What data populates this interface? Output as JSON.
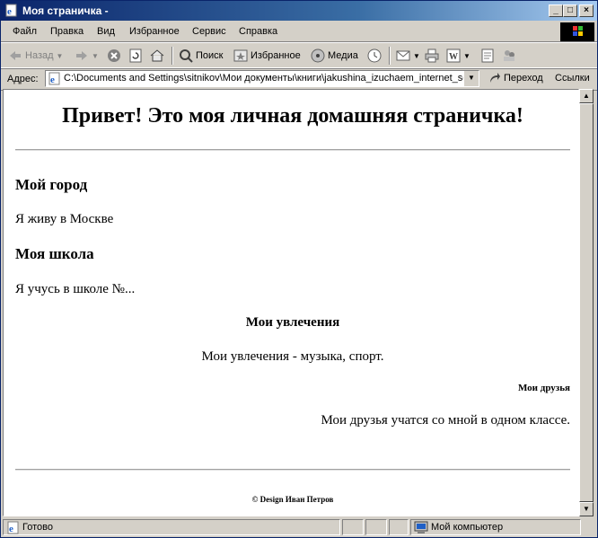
{
  "window": {
    "title": "Моя страничка -",
    "controls": {
      "minimize": "_",
      "maximize": "□",
      "close": "×"
    }
  },
  "menu": {
    "items": [
      "Файл",
      "Правка",
      "Вид",
      "Избранное",
      "Сервис",
      "Справка"
    ]
  },
  "toolbar": {
    "back_label": "Назад",
    "search_label": "Поиск",
    "favorites_label": "Избранное",
    "media_label": "Медиа"
  },
  "address": {
    "label": "Адрес:",
    "value": "C:\\Documents and Settings\\sitnikov\\Мои документы\\книги\\jakushina_izuchaem_internet_so",
    "go_label": "Переход",
    "links_label": "Ссылки"
  },
  "page": {
    "heading": "Привет! Это моя личная домашняя страничка!",
    "city_heading": "Мой город",
    "city_text": "Я живу в Москве",
    "school_heading": "Моя школа",
    "school_text": "Я учусь в школе №...",
    "hobbies_heading": "Мои увлечения",
    "hobbies_text": "Мои увлечения - музыка, спорт.",
    "friends_heading": "Мои друзья",
    "friends_text": "Мои друзья учатся со мной в одном классе.",
    "footer": "© Design Иван Петров"
  },
  "status": {
    "text": "Готово",
    "zone": "Мой компьютер"
  },
  "colors": {
    "title_start": "#0a246a",
    "title_end": "#a6caf0",
    "chrome": "#d4d0c8"
  }
}
